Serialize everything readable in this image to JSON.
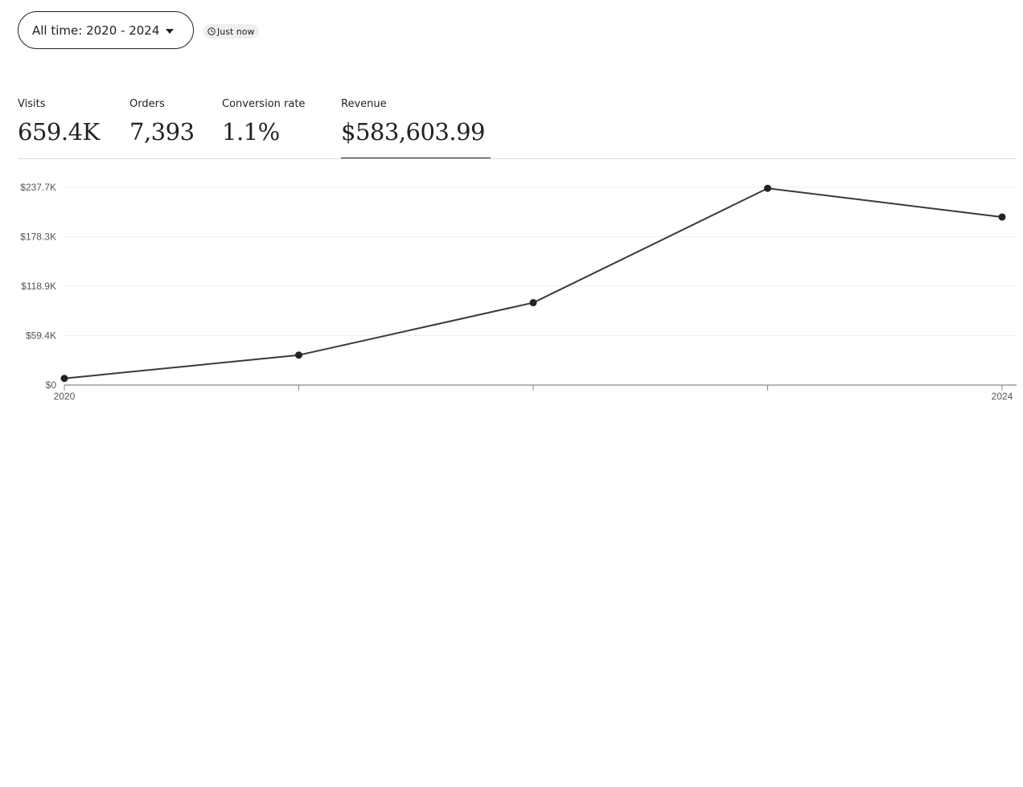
{
  "date_range": {
    "label": "All time: 2020 - 2024",
    "icon": "caret-down-icon"
  },
  "updated_badge": {
    "text": "Just now",
    "icon": "clock-icon"
  },
  "metrics": [
    {
      "label": "Visits",
      "value": "659.4K"
    },
    {
      "label": "Orders",
      "value": "7,393"
    },
    {
      "label": "Conversion rate",
      "value": "1.1%"
    },
    {
      "label": "Revenue",
      "value": "$583,603.99",
      "selected": true
    }
  ],
  "colors": {
    "line": "#3a3a3a",
    "point": "#222222",
    "grid": "#eeeeee",
    "axis": "#888888",
    "selected_underline": "#222222"
  },
  "chart_data": {
    "type": "line",
    "x": [
      2020,
      2021,
      2022,
      2023,
      2024
    ],
    "x_tick_labels": [
      "2020",
      "",
      "",
      "",
      "2024"
    ],
    "series": [
      {
        "values": [
          8000,
          36000,
          99000,
          236500,
          202000
        ]
      }
    ],
    "ylim": [
      0,
      237700
    ],
    "y_ticks": [
      0,
      59400,
      118900,
      178300,
      237700
    ],
    "y_tick_labels": [
      "$0",
      "$59.4K",
      "$118.9K",
      "$178.3K",
      "$237.7K"
    ],
    "grid": true
  }
}
